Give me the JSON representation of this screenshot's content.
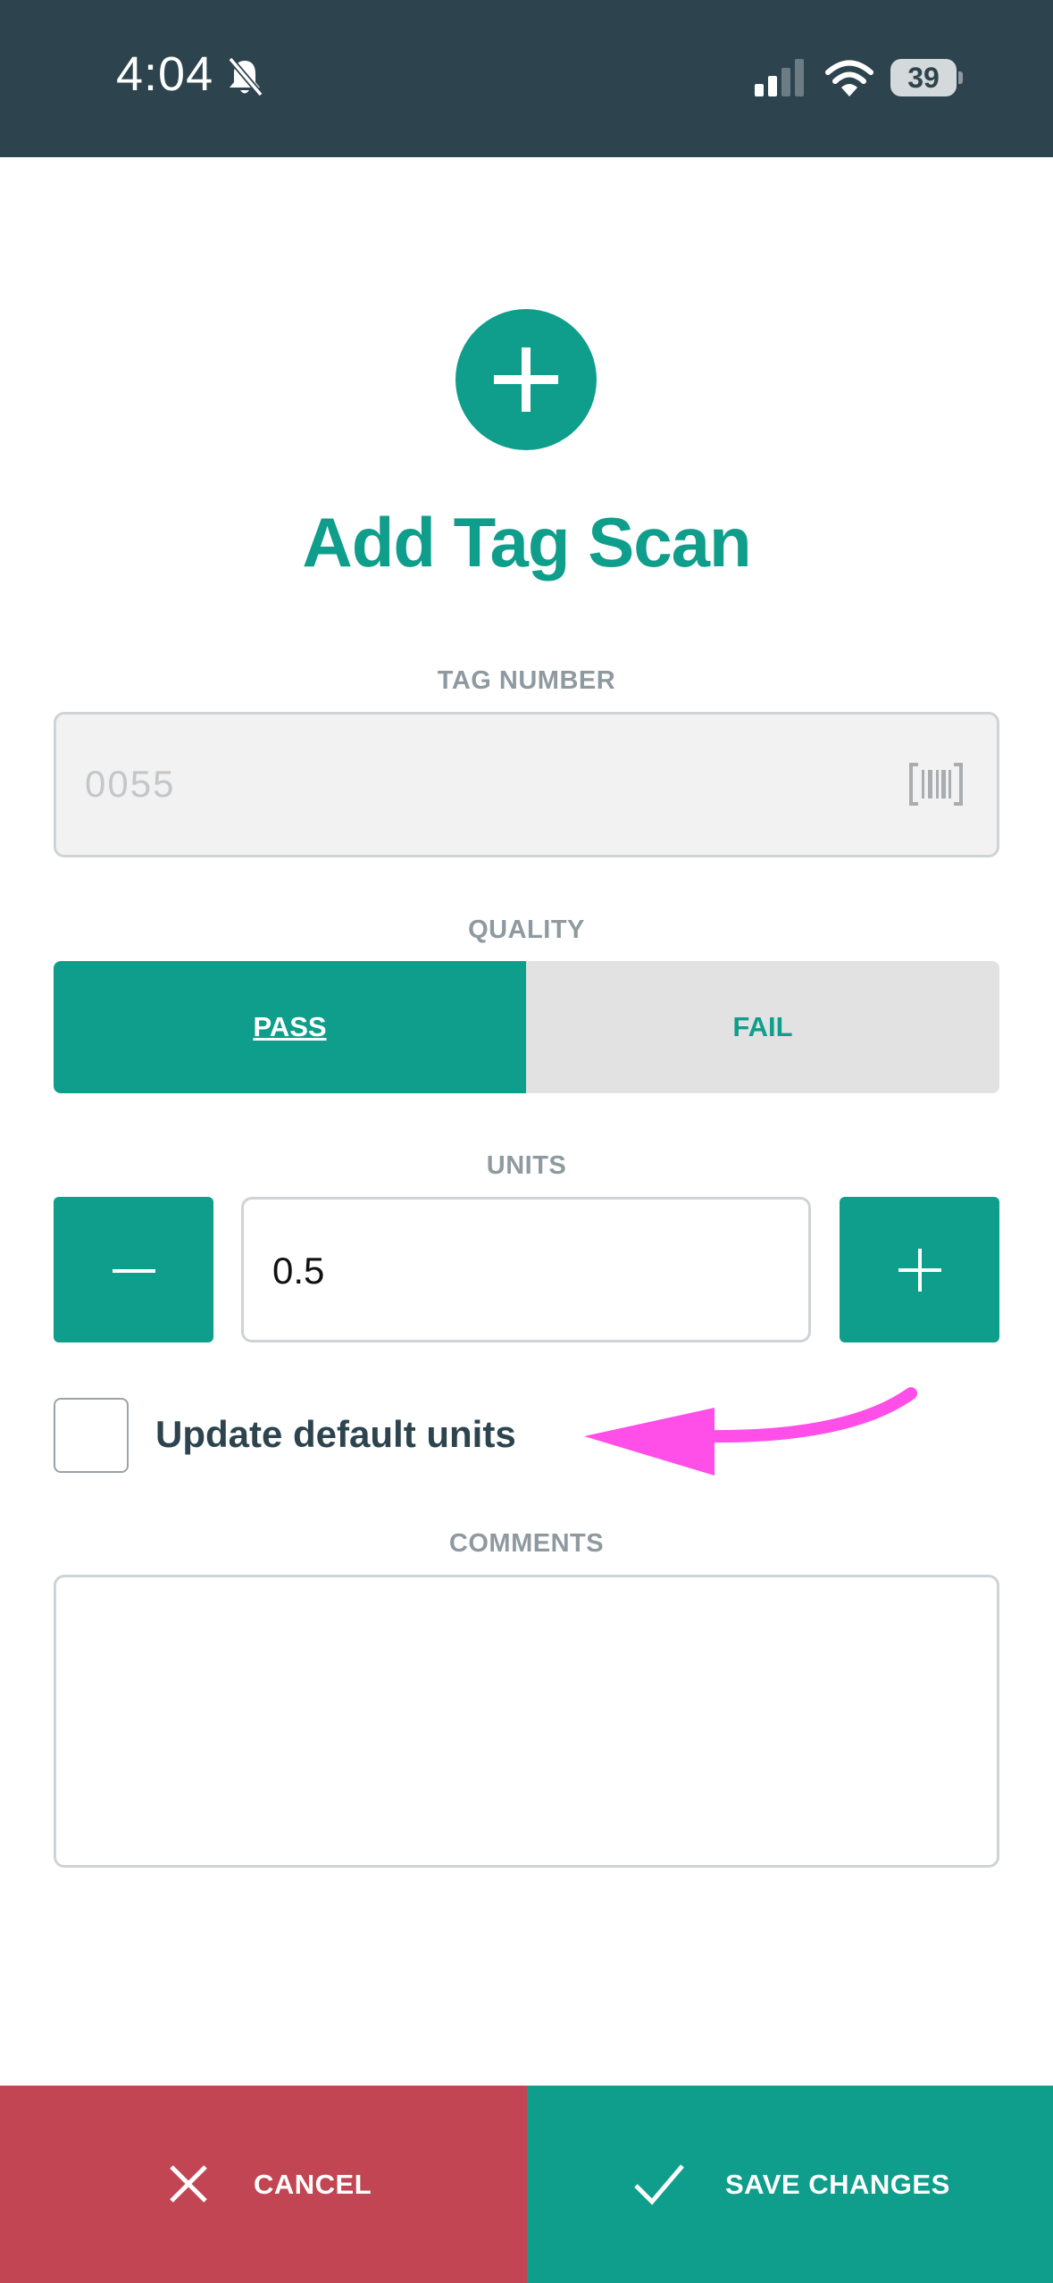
{
  "status_bar": {
    "time": "4:04",
    "battery": "39",
    "icons": [
      "bell-slash-icon",
      "signal-icon",
      "wifi-icon",
      "battery-icon"
    ]
  },
  "header": {
    "icon": "plus-icon",
    "title": "Add Tag Scan"
  },
  "tag": {
    "label": "TAG NUMBER",
    "value": "0055",
    "icon": "barcode-icon"
  },
  "quality": {
    "label": "QUALITY",
    "options": [
      "PASS",
      "FAIL"
    ],
    "selected": "PASS"
  },
  "units": {
    "label": "UNITS",
    "value": "0.5",
    "decrement_icon": "minus-icon",
    "increment_icon": "plus-icon"
  },
  "default_units": {
    "label": "Update default units",
    "checked": false
  },
  "comments": {
    "label": "COMMENTS",
    "value": ""
  },
  "footer": {
    "cancel_label": "CANCEL",
    "save_label": "SAVE CHANGES"
  },
  "colors": {
    "accent": "#0f9e8b",
    "danger": "#c24553",
    "header_bg": "#2d444f",
    "annotation": "#ff4fe8"
  }
}
